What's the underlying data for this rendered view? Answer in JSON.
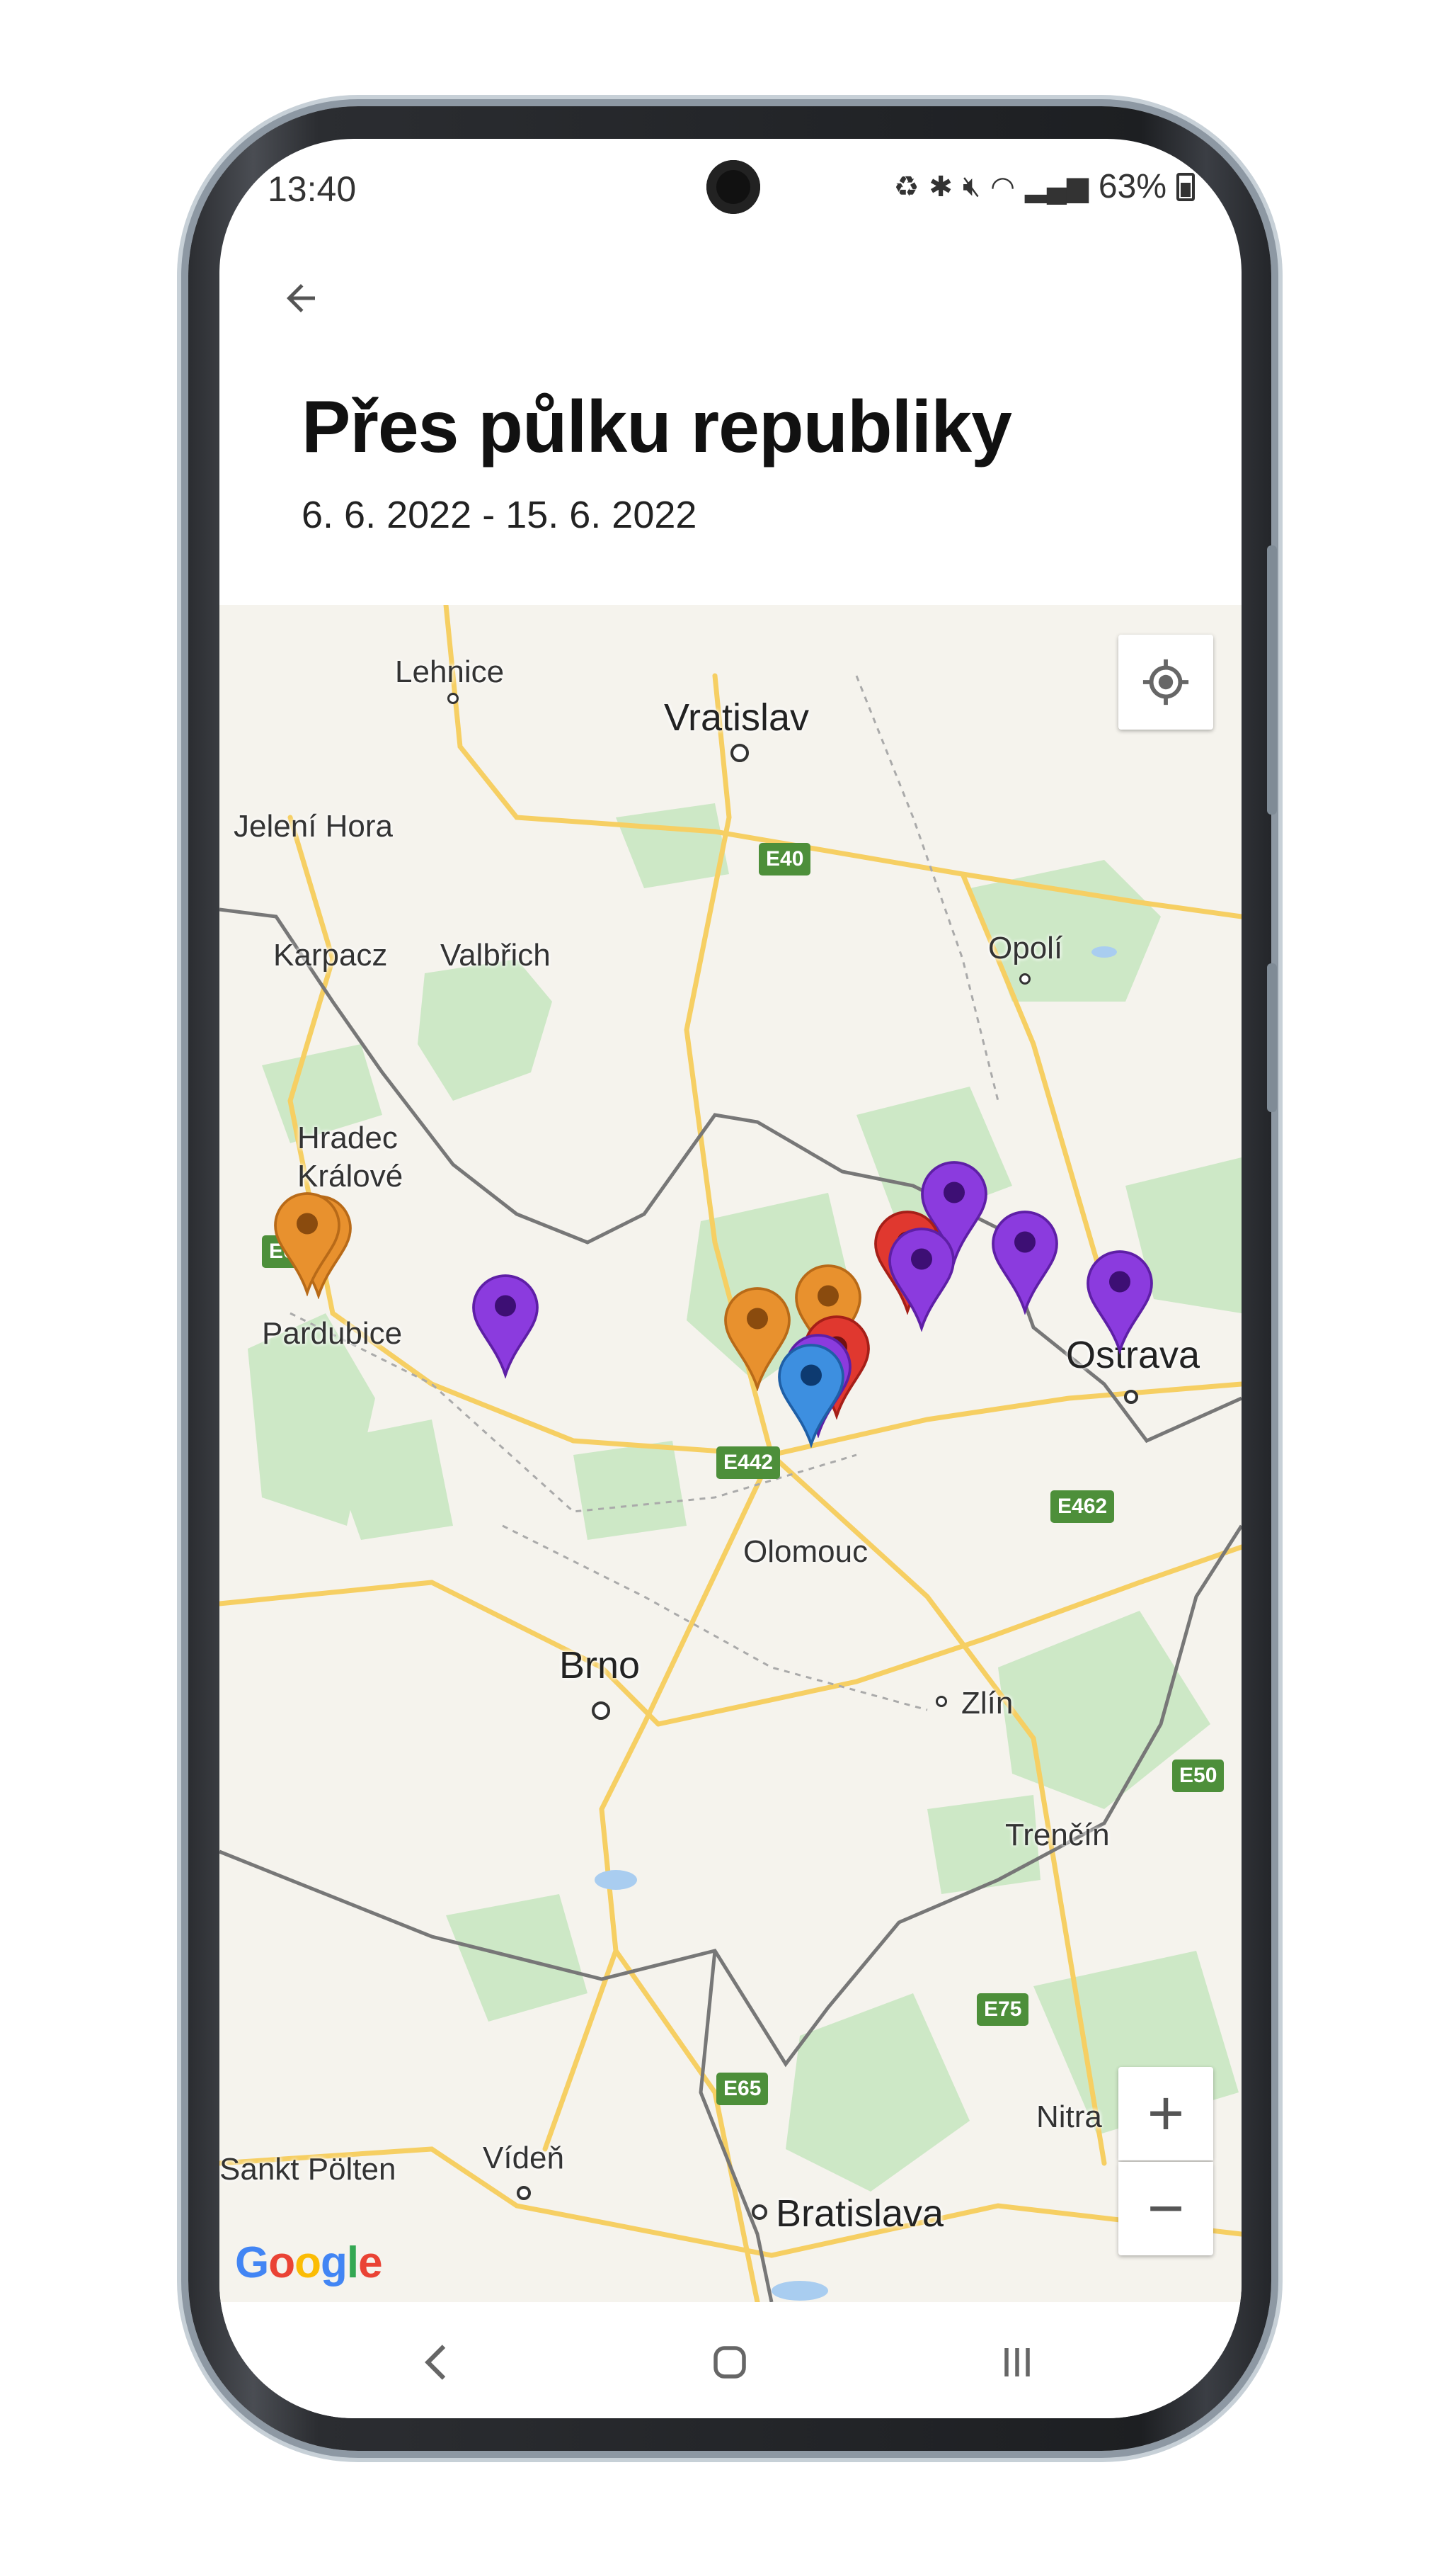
{
  "status_bar": {
    "time": "13:40",
    "battery": "63%"
  },
  "trip": {
    "title": "Přes půlku republiky",
    "dates": "6. 6. 2022 - 15. 6. 2022"
  },
  "map": {
    "labels": {
      "lehnice": "Lehnice",
      "vratislav": "Vratislav",
      "jeleni_hora": "Jelení Hora",
      "karpacz": "Karpacz",
      "valbrich": "Valbřich",
      "opoli": "Opolí",
      "hradec_1": "Hradec",
      "hradec_2": "Králové",
      "pardubice": "Pardubice",
      "ostrava": "Ostrava",
      "olomouc": "Olomouc",
      "brno": "Brno",
      "zlin": "Zlín",
      "trencin": "Trenčín",
      "sankt_polten": "Sankt Pölten",
      "viden": "Vídeň",
      "bratislava": "Bratislava",
      "nitra": "Nitra"
    },
    "roads": {
      "e40": "E40",
      "e6": "E6",
      "e442": "E442",
      "e462": "E462",
      "e50": "E50",
      "e75": "E75",
      "e65": "E65"
    },
    "zoom_in": "+",
    "zoom_out": "−",
    "logo": "Google",
    "marker_colors": {
      "orange": "#e8912e",
      "purple": "#8b3bde",
      "red": "#e0382f",
      "blue": "#3d8fe0"
    }
  }
}
